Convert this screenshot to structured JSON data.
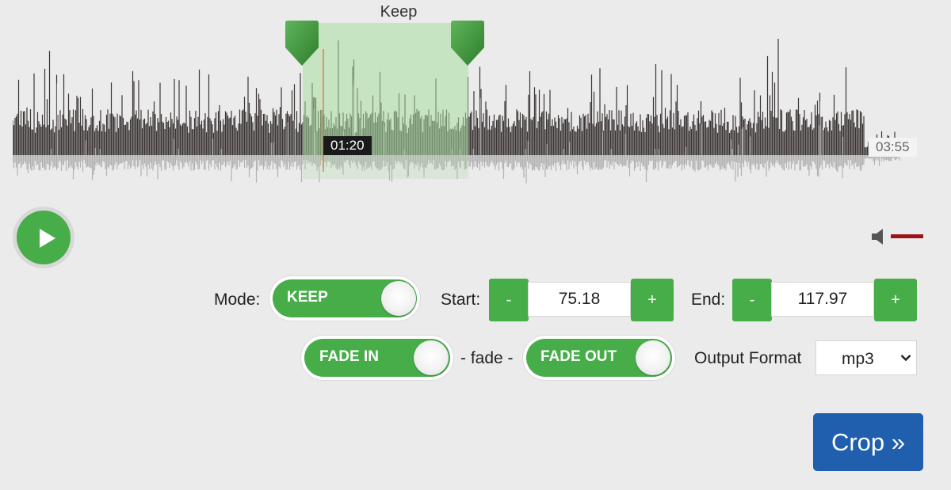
{
  "region": {
    "label": "Keep"
  },
  "waveform": {
    "cursor_time": "01:20",
    "duration": "03:55",
    "colors": {
      "bar": "#3b3535",
      "reflection": "#9a9a9a",
      "region": "#a8dca0",
      "handle": "#3e9a3a",
      "cursor": "#e07a3a"
    }
  },
  "player": {
    "play_icon": "play-icon",
    "volume_icon": "speaker-icon",
    "volume_level": 1.0
  },
  "mode": {
    "label": "Mode:",
    "toggle_text": "KEEP"
  },
  "start": {
    "label": "Start:",
    "minus": "-",
    "value": "75.18",
    "plus": "+"
  },
  "end": {
    "label": "End:",
    "minus": "-",
    "value": "117.97",
    "plus": "+"
  },
  "fade": {
    "in_text": "FADE IN",
    "separator": "- fade -",
    "out_text": "FADE OUT"
  },
  "output": {
    "label": "Output Format",
    "selected": "mp3"
  },
  "crop": {
    "label": "Crop »"
  },
  "colors": {
    "accent_green": "#47ad49",
    "crop_blue": "#1f5fad",
    "volume_red": "#9f1118"
  }
}
